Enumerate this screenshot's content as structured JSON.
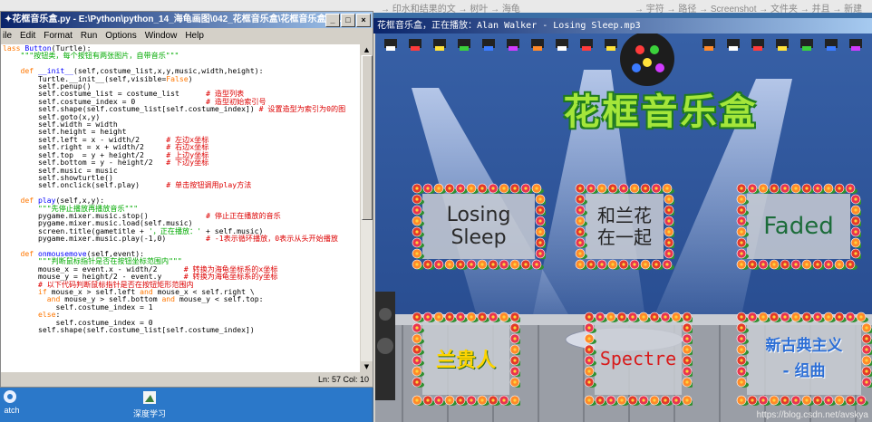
{
  "desktop": {
    "top_ghost_text": [
      "→ 印水和结果的文 → 树叶 → 海龟",
      "→ 宇符 → 路径 → Screenshot → 文件夹 → 并且 → 新建"
    ],
    "icons": [
      {
        "label": "atch"
      },
      {
        "label": "深度学习"
      }
    ]
  },
  "idle": {
    "title": "✦花框音乐盒.py - E:\\Python\\python_14_海龟画图\\042_花框音乐盒\\花框音乐盒.p...",
    "window_buttons": [
      "_",
      "□",
      "×"
    ],
    "menu": [
      "ile",
      "Edit",
      "Format",
      "Run",
      "Options",
      "Window",
      "Help"
    ],
    "status": "Ln: 57  Col: 10"
  },
  "game": {
    "title": "花框音乐盒，正在播放：Alan Walker - Losing Sleep.mp3",
    "heading": "花框音乐盒",
    "buttons": [
      {
        "label": "Losing\nSleep",
        "color": "#2a2a2a"
      },
      {
        "label": "和兰花\n在一起",
        "color": "#222222"
      },
      {
        "label": "Faded",
        "color": "#1c6c3a"
      },
      {
        "label": "兰贵人",
        "color": "#ffd400"
      },
      {
        "label": "Spectre",
        "color": "#d81b1b"
      },
      {
        "label": "新古典主义\n- 组曲",
        "color": "#2d6fd6"
      }
    ],
    "watermark": "https://blog.csdn.net/avskya"
  },
  "colors": {
    "title_blue": "#0a246a",
    "stage_blue": "#3760a6",
    "heading_green": "#a4e63a",
    "frame_green": "#1f7a1f"
  }
}
